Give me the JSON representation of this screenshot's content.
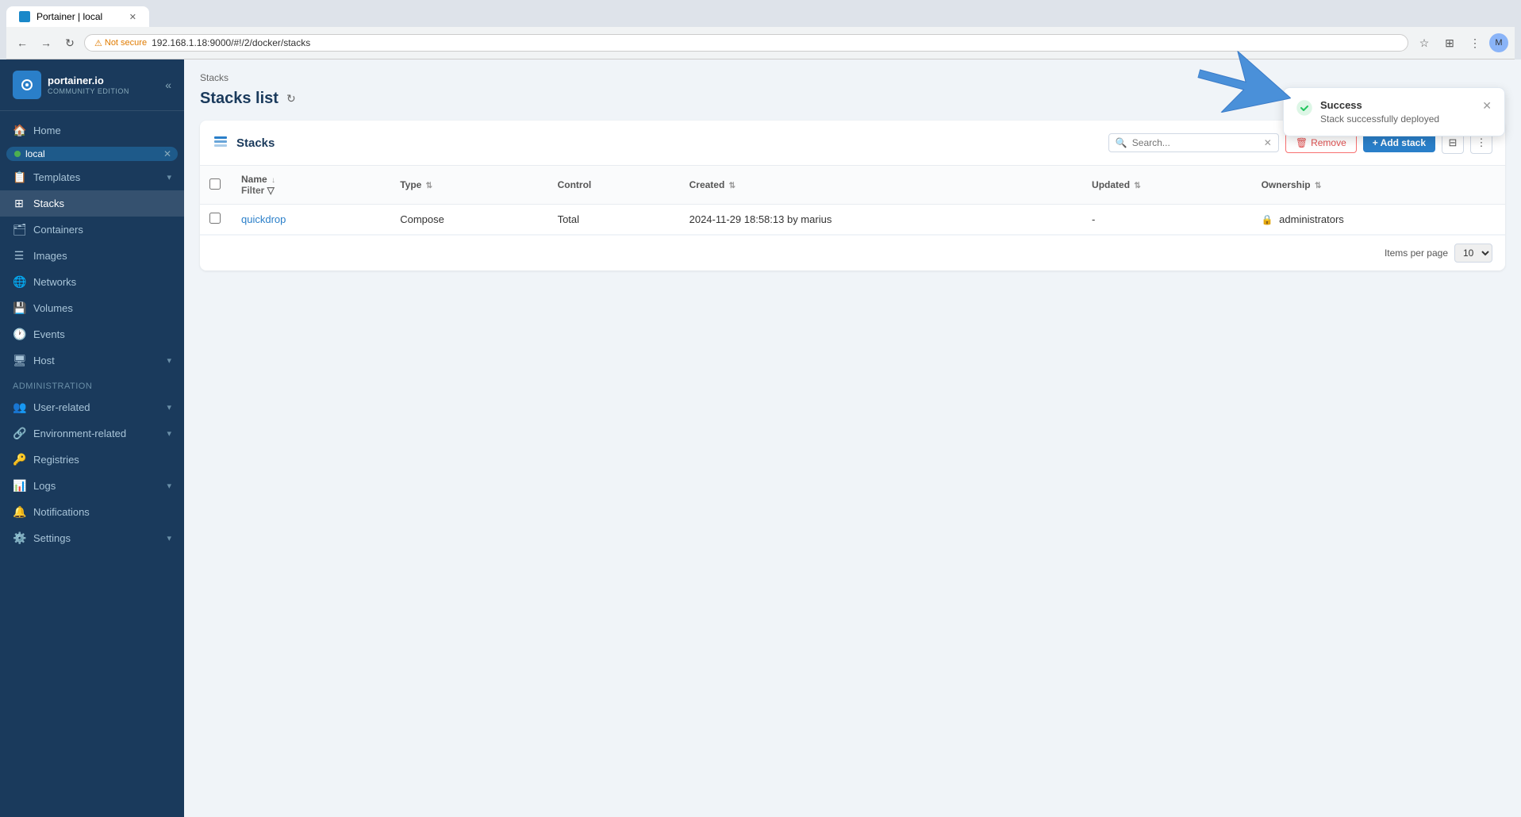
{
  "browser": {
    "tab_title": "Portainer | local",
    "address": "192.168.1.18:9000/#!/2/docker/stacks",
    "not_secure_label": "Not secure"
  },
  "sidebar": {
    "logo_text": "portainer.io",
    "logo_sub": "Community Edition",
    "env_name": "local",
    "nav_items": [
      {
        "id": "home",
        "label": "Home",
        "icon": "🏠"
      },
      {
        "id": "templates",
        "label": "Templates",
        "icon": "📋",
        "has_arrow": true
      },
      {
        "id": "stacks",
        "label": "Stacks",
        "icon": "📦",
        "active": true
      },
      {
        "id": "containers",
        "label": "Containers",
        "icon": "🗂️"
      },
      {
        "id": "images",
        "label": "Images",
        "icon": "☰"
      },
      {
        "id": "networks",
        "label": "Networks",
        "icon": "🌐"
      },
      {
        "id": "volumes",
        "label": "Volumes",
        "icon": "💾"
      },
      {
        "id": "events",
        "label": "Events",
        "icon": "🕐"
      },
      {
        "id": "host",
        "label": "Host",
        "icon": "🖥️",
        "has_arrow": true
      }
    ],
    "admin_section": "Administration",
    "admin_items": [
      {
        "id": "user-related",
        "label": "User-related",
        "icon": "👥",
        "has_arrow": true
      },
      {
        "id": "environment-related",
        "label": "Environment-related",
        "icon": "🔗",
        "has_arrow": true
      },
      {
        "id": "registries",
        "label": "Registries",
        "icon": "🔑"
      },
      {
        "id": "logs",
        "label": "Logs",
        "icon": "📊",
        "has_arrow": true
      },
      {
        "id": "notifications",
        "label": "Notifications",
        "icon": "🔔"
      },
      {
        "id": "settings",
        "label": "Settings",
        "icon": "⚙️",
        "has_arrow": true
      }
    ]
  },
  "page": {
    "breadcrumb": "Stacks",
    "title": "Stacks list"
  },
  "panel": {
    "title": "Stacks",
    "search_placeholder": "Search...",
    "remove_label": "Remove",
    "add_label": "+ Add stack"
  },
  "table": {
    "columns": [
      {
        "id": "name",
        "label": "Name",
        "sortable": true
      },
      {
        "id": "type",
        "label": "Type",
        "sortable": true
      },
      {
        "id": "control",
        "label": "Control",
        "sortable": false
      },
      {
        "id": "created",
        "label": "Created",
        "sortable": true
      },
      {
        "id": "updated",
        "label": "Updated",
        "sortable": true
      },
      {
        "id": "ownership",
        "label": "Ownership",
        "sortable": true
      }
    ],
    "rows": [
      {
        "name": "quickdrop",
        "type": "Compose",
        "control": "Total",
        "created": "2024-11-29 18:58:13 by marius",
        "updated": "-",
        "ownership": "administrators"
      }
    ],
    "items_per_page_label": "Items per page",
    "items_per_page_value": "10"
  },
  "toast": {
    "title": "Success",
    "message": "Stack successfully deployed",
    "icon": "✓"
  }
}
